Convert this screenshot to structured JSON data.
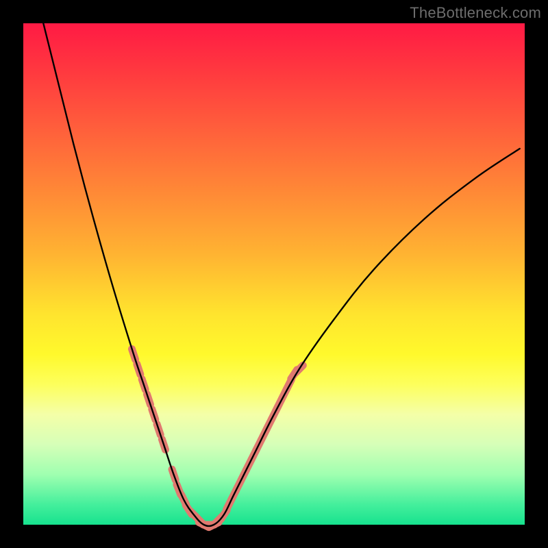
{
  "watermark": "TheBottleneck.com",
  "colors": {
    "frame": "#000000",
    "curve_stroke": "#000000",
    "overlay_dot": "#e0796f",
    "gradient_top": "#ff1a44",
    "gradient_bottom": "#17e28e"
  },
  "chart_data": {
    "type": "line",
    "title": "",
    "xlabel": "",
    "ylabel": "",
    "xlim": [
      0,
      100
    ],
    "ylim": [
      0,
      100
    ],
    "grid": false,
    "series": [
      {
        "name": "bottleneck-curve",
        "x": [
          3,
          6,
          10,
          14,
          18,
          22,
          24,
          26,
          28,
          30,
          32,
          34,
          36,
          38,
          40,
          42,
          46,
          50,
          55,
          62,
          70,
          80,
          90,
          99
        ],
        "y": [
          104,
          92,
          76,
          61,
          47,
          34,
          28,
          22,
          16,
          10,
          5,
          2,
          0,
          0,
          2,
          6,
          14,
          22,
          31,
          41,
          51,
          61,
          69,
          75
        ]
      }
    ],
    "overlay_points": {
      "name": "salmon-markers",
      "color": "#e0796f",
      "points": [
        {
          "x": 22,
          "y": 34
        },
        {
          "x": 23,
          "y": 31
        },
        {
          "x": 24,
          "y": 28
        },
        {
          "x": 25,
          "y": 25
        },
        {
          "x": 26,
          "y": 22
        },
        {
          "x": 27,
          "y": 19
        },
        {
          "x": 28,
          "y": 16
        },
        {
          "x": 30,
          "y": 10
        },
        {
          "x": 31,
          "y": 7
        },
        {
          "x": 32,
          "y": 5
        },
        {
          "x": 33,
          "y": 3
        },
        {
          "x": 34,
          "y": 2
        },
        {
          "x": 35,
          "y": 1
        },
        {
          "x": 36,
          "y": 0
        },
        {
          "x": 37,
          "y": 0
        },
        {
          "x": 38,
          "y": 0
        },
        {
          "x": 39,
          "y": 1
        },
        {
          "x": 40,
          "y": 2
        },
        {
          "x": 41,
          "y": 4
        },
        {
          "x": 42,
          "y": 6
        },
        {
          "x": 43,
          "y": 8
        },
        {
          "x": 44,
          "y": 10
        },
        {
          "x": 45,
          "y": 12
        },
        {
          "x": 46,
          "y": 14
        },
        {
          "x": 47,
          "y": 16
        },
        {
          "x": 48,
          "y": 18
        },
        {
          "x": 49,
          "y": 20
        },
        {
          "x": 50,
          "y": 22
        },
        {
          "x": 51,
          "y": 24
        },
        {
          "x": 52,
          "y": 26
        },
        {
          "x": 53,
          "y": 28
        },
        {
          "x": 54,
          "y": 30
        },
        {
          "x": 55,
          "y": 31
        }
      ]
    }
  }
}
